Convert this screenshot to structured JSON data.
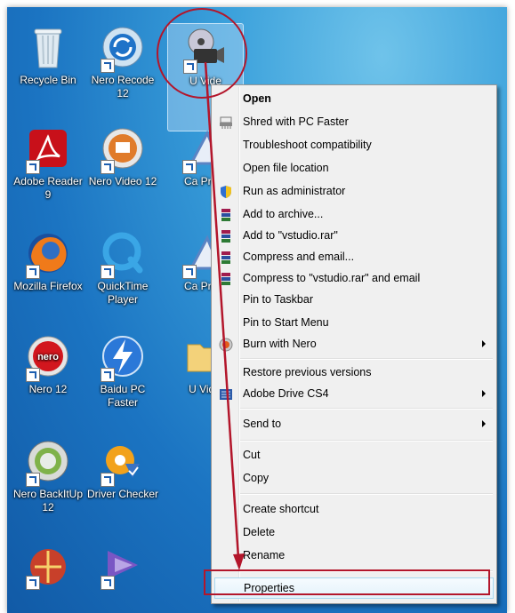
{
  "desktop": {
    "icons": [
      {
        "label": "Recycle Bin",
        "icon": "recycle-bin-icon"
      },
      {
        "label": "Nero Recode 12",
        "icon": "nero-recode-icon"
      },
      {
        "label": "U Vide",
        "icon": "video-camera-icon"
      },
      {
        "label": "Adobe Reader 9",
        "icon": "adobe-reader-icon"
      },
      {
        "label": "Nero Video 12",
        "icon": "nero-video-icon"
      },
      {
        "label": "Ca ProC",
        "icon": "camtasia-icon"
      },
      {
        "label": "Mozilla Firefox",
        "icon": "firefox-icon"
      },
      {
        "label": "QuickTime Player",
        "icon": "quicktime-icon"
      },
      {
        "label": "Ca ProC",
        "icon": "camtasia-icon"
      },
      {
        "label": "Nero 12",
        "icon": "nero-icon"
      },
      {
        "label": "Baidu PC Faster",
        "icon": "baidu-pc-faster-icon"
      },
      {
        "label": "U Vide",
        "icon": "folder-icon"
      },
      {
        "label": "Nero BackItUp 12",
        "icon": "nero-backitup-icon"
      },
      {
        "label": "Driver Checker",
        "icon": "driver-checker-icon"
      }
    ]
  },
  "menu": {
    "items": [
      {
        "label": "Open"
      },
      {
        "label": "Shred with PC Faster",
        "icon": "shredder-icon"
      },
      {
        "label": "Troubleshoot compatibility"
      },
      {
        "label": "Open file location"
      },
      {
        "label": "Run as administrator",
        "icon": "shield-icon"
      },
      {
        "label": "Add to archive...",
        "icon": "winrar-icon"
      },
      {
        "label": "Add to \"vstudio.rar\"",
        "icon": "winrar-icon"
      },
      {
        "label": "Compress and email...",
        "icon": "winrar-icon"
      },
      {
        "label": "Compress to \"vstudio.rar\" and email",
        "icon": "winrar-icon"
      },
      {
        "label": "Pin to Taskbar"
      },
      {
        "label": "Pin to Start Menu"
      },
      {
        "label": "Burn with Nero",
        "icon": "nero-burn-icon"
      },
      {
        "label": "Restore previous versions"
      },
      {
        "label": "Adobe Drive CS4",
        "icon": "adobe-drive-icon"
      },
      {
        "label": "Send to"
      },
      {
        "label": "Cut"
      },
      {
        "label": "Copy"
      },
      {
        "label": "Create shortcut"
      },
      {
        "label": "Delete"
      },
      {
        "label": "Rename"
      },
      {
        "label": "Properties"
      }
    ]
  },
  "colors": {
    "annotation": "#b3162b",
    "selection": "#a8d8f0"
  }
}
